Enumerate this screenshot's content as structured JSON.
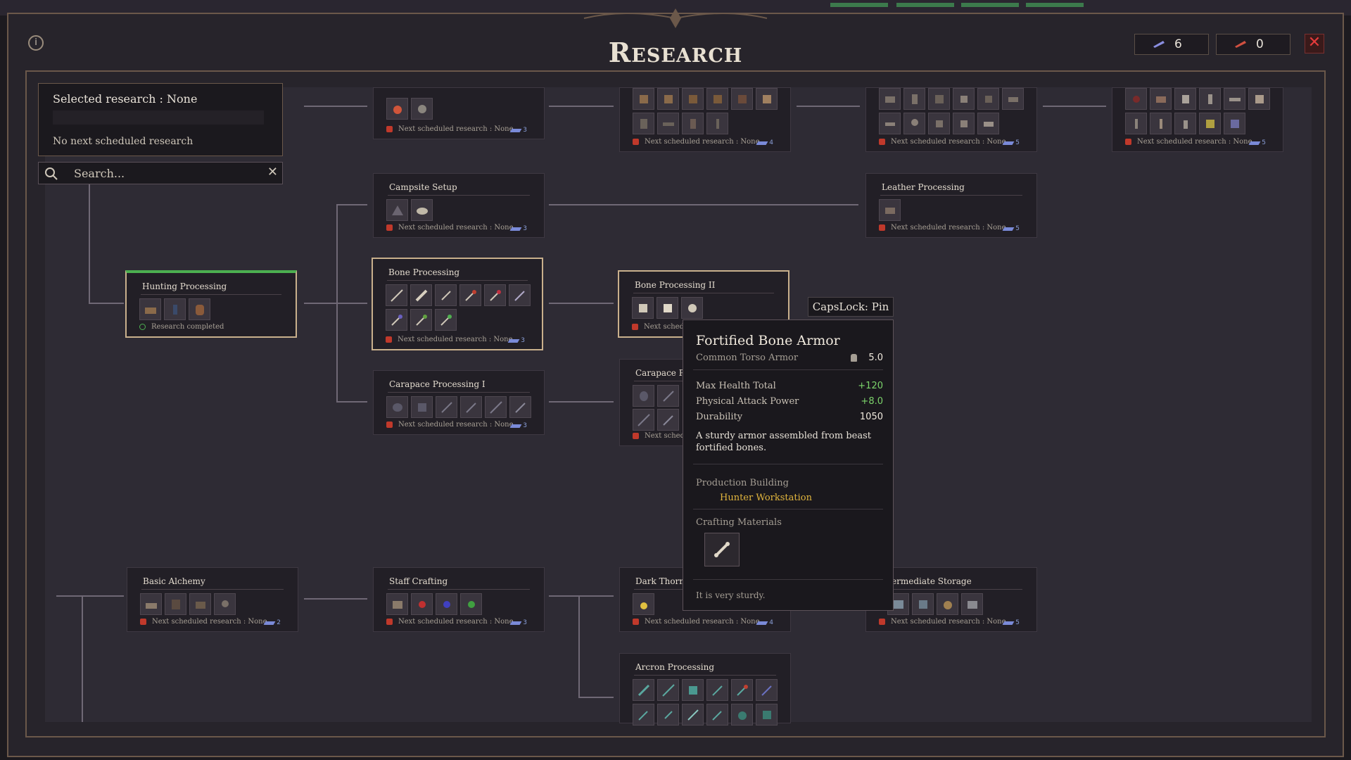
{
  "window": {
    "title": "Research"
  },
  "resources": [
    {
      "value": "6",
      "color": "#8a8ee0"
    },
    {
      "value": "0",
      "color": "#d05040"
    }
  ],
  "selected": {
    "title": "Selected research : None",
    "next": "No next scheduled research"
  },
  "search": {
    "placeholder": "Search..."
  },
  "nodes": {
    "campsite": {
      "title": "Campsite Setup",
      "status": "Next scheduled research : None",
      "cost": "3"
    },
    "leather": {
      "title": "Leather Processing",
      "status": "Next scheduled research : None",
      "cost": "5"
    },
    "hunting": {
      "title": "Hunting Processing",
      "status": "Research completed"
    },
    "bone1": {
      "title": "Bone Processing",
      "status": "Next scheduled research : None",
      "cost": "3"
    },
    "bone2": {
      "title": "Bone Processing II",
      "status": "Next sched"
    },
    "carapace1": {
      "title": "Carapace Processing I",
      "status": "Next scheduled research : None",
      "cost": "3"
    },
    "carapace2": {
      "title": "Carapace Pro",
      "status": "Next sched"
    },
    "alchemy": {
      "title": "Basic Alchemy",
      "status": "Next scheduled research : None",
      "cost": "2"
    },
    "staff": {
      "title": "Staff Crafting",
      "status": "Next scheduled research : None",
      "cost": "3"
    },
    "darkthorn": {
      "title": "Dark Thorn V",
      "status": "Next scheduled research : None",
      "cost": "4"
    },
    "storage": {
      "title": "ermediate Storage",
      "status": "Next scheduled research : None",
      "cost": "5"
    },
    "arcron": {
      "title": "Arcron Processing"
    },
    "top1": {
      "status": "Next scheduled research : None",
      "cost": "3"
    },
    "top2": {
      "status": "Next scheduled research : None",
      "cost": "4"
    },
    "top3": {
      "status": "Next scheduled research : None",
      "cost": "5"
    },
    "top4": {
      "status": "Next scheduled research : None",
      "cost": "5"
    }
  },
  "pin_hint": "CapsLock: Pin",
  "tooltip": {
    "name": "Fortified Bone Armor",
    "subtype": "Common Torso Armor",
    "weight": "5.0",
    "stats": [
      {
        "label": "Max Health Total",
        "value": "+120"
      },
      {
        "label": "Physical Attack Power",
        "value": "+8.0"
      },
      {
        "label": "Durability",
        "value": "1050"
      }
    ],
    "description": "A sturdy armor assembled from beast fortified bones.",
    "production_label": "Production Building",
    "building": "Hunter Workstation",
    "materials_label": "Crafting Materials",
    "flavor": "It is very sturdy."
  }
}
